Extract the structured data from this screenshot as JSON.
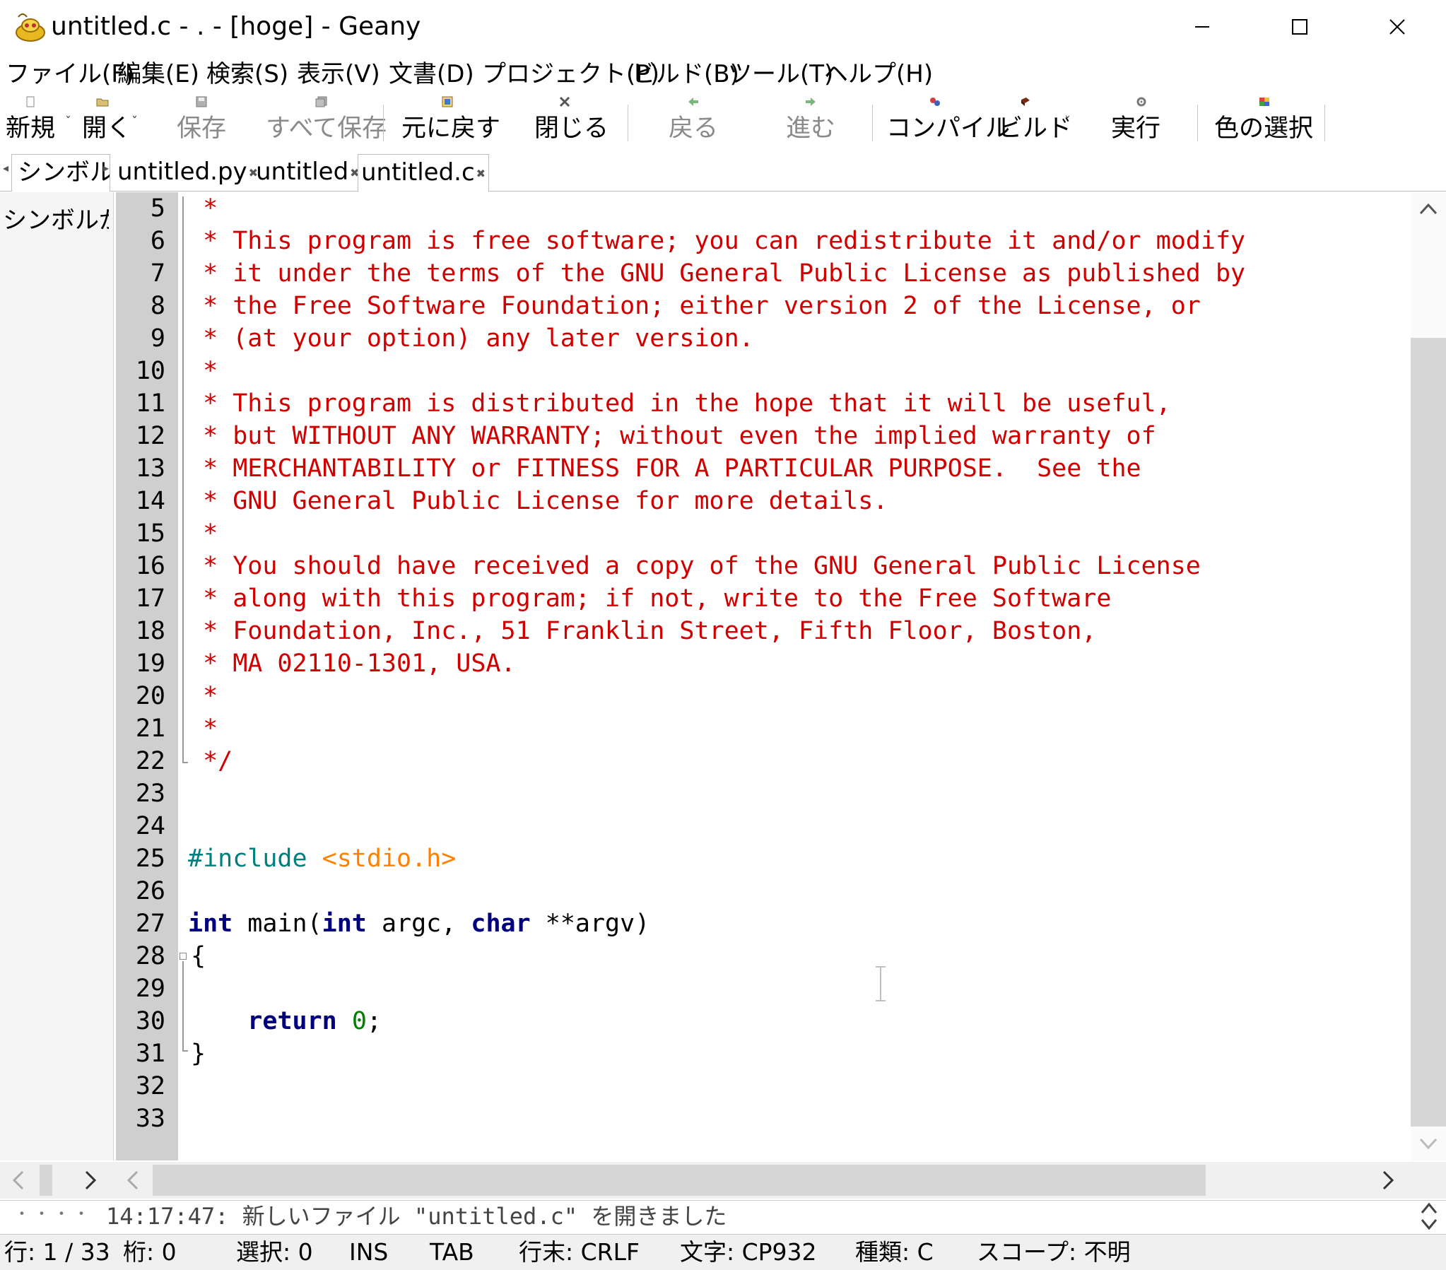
{
  "window": {
    "title": "untitled.c - . - [hoge] - Geany",
    "minimize": "─",
    "maximize": "☐",
    "close": "✕"
  },
  "menu": [
    "ファイル(F)",
    "編集(E)",
    "検索(S)",
    "表示(V)",
    "文書(D)",
    "プロジェクト(P)",
    "ビルド(B)",
    "ツール(T)",
    "ヘルプ(H)"
  ],
  "toolbar": {
    "new": "新規",
    "open": "開く",
    "save": "保存",
    "save_all": "すべて保存",
    "revert": "元に戻す",
    "close": "閉じる",
    "back": "戻る",
    "forward": "進む",
    "compile": "コンパイル",
    "build": "ビルド",
    "run": "実行",
    "color": "色の選択"
  },
  "sidebar": {
    "tab": "シンボル",
    "text": "シンボルがありません"
  },
  "tabs": [
    "untitled.py",
    "untitled",
    "untitled.c"
  ],
  "editor": {
    "line_numbers": [
      "5",
      "6",
      "7",
      "8",
      "9",
      "10",
      "11",
      "12",
      "13",
      "14",
      "15",
      "16",
      "17",
      "18",
      "19",
      "20",
      "21",
      "22",
      "23",
      "24",
      "25",
      "26",
      "27",
      "28",
      "29",
      "30",
      "31",
      "32",
      "33"
    ],
    "comment_lines": [
      " *",
      " * This program is free software; you can redistribute it and/or modify",
      " * it under the terms of the GNU General Public License as published by",
      " * the Free Software Foundation; either version 2 of the License, or",
      " * (at your option) any later version.",
      " *",
      " * This program is distributed in the hope that it will be useful,",
      " * but WITHOUT ANY WARRANTY; without even the implied warranty of",
      " * MERCHANTABILITY or FITNESS FOR A PARTICULAR PURPOSE.  See the",
      " * GNU General Public License for more details.",
      " *",
      " * You should have received a copy of the GNU General Public License",
      " * along with this program; if not, write to the Free Software",
      " * Foundation, Inc., 51 Franklin Street, Fifth Floor, Boston,",
      " * MA 02110-1301, USA.",
      " *",
      " *",
      " */"
    ],
    "include_directive": "#include",
    "include_file": "<stdio.h>",
    "kw_int": "int",
    "main_text": " main(",
    "argc_text": " argc, ",
    "kw_char": "char",
    "argv_text": " **argv)",
    "open_brace": "{",
    "kw_return": "return",
    "zero": "0",
    "semicolon": ";",
    "close_brace": "}"
  },
  "message": "14:17:47: 新しいファイル \"untitled.c\" を開きました",
  "status": {
    "line": "行: 1 / 33",
    "col": "桁: 0",
    "sel": "選択: 0",
    "ins": "INS",
    "tab": "TAB",
    "eol": "行末: CRLF",
    "enc": "文字: CP932",
    "type": "種類: C",
    "scope": "スコープ: 不明"
  },
  "colors": {
    "comment": "#d00000",
    "preprocessor": "#007f7f",
    "string": "#ff8000",
    "keyword": "#00007f",
    "number": "#007f00"
  }
}
